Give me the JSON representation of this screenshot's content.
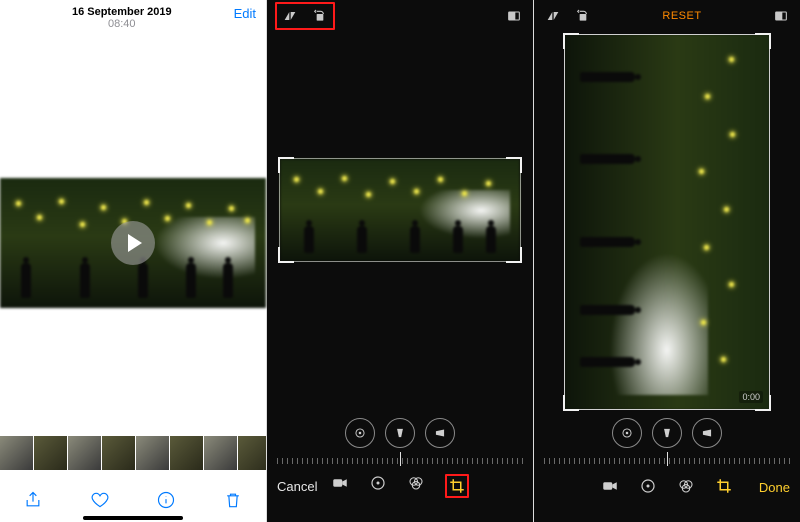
{
  "panel1": {
    "date": "16 September 2019",
    "time": "08:40",
    "edit": "Edit",
    "toolbar": [
      "share",
      "favorite",
      "info",
      "trash"
    ]
  },
  "panel2": {
    "header_left": [
      "flip-icon",
      "rotate-icon"
    ],
    "header_right": "aspect-icon",
    "adjust": [
      "straighten",
      "vertical-skew",
      "horizontal-skew"
    ],
    "cancel": "Cancel",
    "modes": [
      "video",
      "adjust",
      "filters",
      "crop"
    ],
    "active_mode": "crop",
    "highlight_header": true,
    "highlight_crop_mode": true
  },
  "panel3": {
    "header_left": [
      "flip-icon",
      "rotate-icon"
    ],
    "reset": "RESET",
    "header_right": "aspect-icon",
    "adjust": [
      "straighten",
      "vertical-skew",
      "horizontal-skew"
    ],
    "done": "Done",
    "modes": [
      "video",
      "adjust",
      "filters",
      "crop"
    ],
    "active_mode": "crop",
    "timecode": "0:00"
  }
}
